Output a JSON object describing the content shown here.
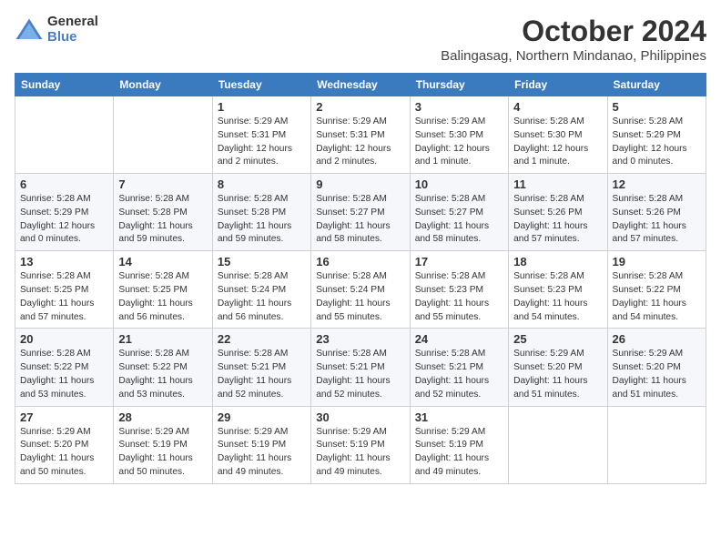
{
  "logo": {
    "general": "General",
    "blue": "Blue"
  },
  "title": "October 2024",
  "location": "Balingasag, Northern Mindanao, Philippines",
  "headers": [
    "Sunday",
    "Monday",
    "Tuesday",
    "Wednesday",
    "Thursday",
    "Friday",
    "Saturday"
  ],
  "weeks": [
    [
      {
        "day": "",
        "info": ""
      },
      {
        "day": "",
        "info": ""
      },
      {
        "day": "1",
        "info": "Sunrise: 5:29 AM\nSunset: 5:31 PM\nDaylight: 12 hours\nand 2 minutes."
      },
      {
        "day": "2",
        "info": "Sunrise: 5:29 AM\nSunset: 5:31 PM\nDaylight: 12 hours\nand 2 minutes."
      },
      {
        "day": "3",
        "info": "Sunrise: 5:29 AM\nSunset: 5:30 PM\nDaylight: 12 hours\nand 1 minute."
      },
      {
        "day": "4",
        "info": "Sunrise: 5:28 AM\nSunset: 5:30 PM\nDaylight: 12 hours\nand 1 minute."
      },
      {
        "day": "5",
        "info": "Sunrise: 5:28 AM\nSunset: 5:29 PM\nDaylight: 12 hours\nand 0 minutes."
      }
    ],
    [
      {
        "day": "6",
        "info": "Sunrise: 5:28 AM\nSunset: 5:29 PM\nDaylight: 12 hours\nand 0 minutes."
      },
      {
        "day": "7",
        "info": "Sunrise: 5:28 AM\nSunset: 5:28 PM\nDaylight: 11 hours\nand 59 minutes."
      },
      {
        "day": "8",
        "info": "Sunrise: 5:28 AM\nSunset: 5:28 PM\nDaylight: 11 hours\nand 59 minutes."
      },
      {
        "day": "9",
        "info": "Sunrise: 5:28 AM\nSunset: 5:27 PM\nDaylight: 11 hours\nand 58 minutes."
      },
      {
        "day": "10",
        "info": "Sunrise: 5:28 AM\nSunset: 5:27 PM\nDaylight: 11 hours\nand 58 minutes."
      },
      {
        "day": "11",
        "info": "Sunrise: 5:28 AM\nSunset: 5:26 PM\nDaylight: 11 hours\nand 57 minutes."
      },
      {
        "day": "12",
        "info": "Sunrise: 5:28 AM\nSunset: 5:26 PM\nDaylight: 11 hours\nand 57 minutes."
      }
    ],
    [
      {
        "day": "13",
        "info": "Sunrise: 5:28 AM\nSunset: 5:25 PM\nDaylight: 11 hours\nand 57 minutes."
      },
      {
        "day": "14",
        "info": "Sunrise: 5:28 AM\nSunset: 5:25 PM\nDaylight: 11 hours\nand 56 minutes."
      },
      {
        "day": "15",
        "info": "Sunrise: 5:28 AM\nSunset: 5:24 PM\nDaylight: 11 hours\nand 56 minutes."
      },
      {
        "day": "16",
        "info": "Sunrise: 5:28 AM\nSunset: 5:24 PM\nDaylight: 11 hours\nand 55 minutes."
      },
      {
        "day": "17",
        "info": "Sunrise: 5:28 AM\nSunset: 5:23 PM\nDaylight: 11 hours\nand 55 minutes."
      },
      {
        "day": "18",
        "info": "Sunrise: 5:28 AM\nSunset: 5:23 PM\nDaylight: 11 hours\nand 54 minutes."
      },
      {
        "day": "19",
        "info": "Sunrise: 5:28 AM\nSunset: 5:22 PM\nDaylight: 11 hours\nand 54 minutes."
      }
    ],
    [
      {
        "day": "20",
        "info": "Sunrise: 5:28 AM\nSunset: 5:22 PM\nDaylight: 11 hours\nand 53 minutes."
      },
      {
        "day": "21",
        "info": "Sunrise: 5:28 AM\nSunset: 5:22 PM\nDaylight: 11 hours\nand 53 minutes."
      },
      {
        "day": "22",
        "info": "Sunrise: 5:28 AM\nSunset: 5:21 PM\nDaylight: 11 hours\nand 52 minutes."
      },
      {
        "day": "23",
        "info": "Sunrise: 5:28 AM\nSunset: 5:21 PM\nDaylight: 11 hours\nand 52 minutes."
      },
      {
        "day": "24",
        "info": "Sunrise: 5:28 AM\nSunset: 5:21 PM\nDaylight: 11 hours\nand 52 minutes."
      },
      {
        "day": "25",
        "info": "Sunrise: 5:29 AM\nSunset: 5:20 PM\nDaylight: 11 hours\nand 51 minutes."
      },
      {
        "day": "26",
        "info": "Sunrise: 5:29 AM\nSunset: 5:20 PM\nDaylight: 11 hours\nand 51 minutes."
      }
    ],
    [
      {
        "day": "27",
        "info": "Sunrise: 5:29 AM\nSunset: 5:20 PM\nDaylight: 11 hours\nand 50 minutes."
      },
      {
        "day": "28",
        "info": "Sunrise: 5:29 AM\nSunset: 5:19 PM\nDaylight: 11 hours\nand 50 minutes."
      },
      {
        "day": "29",
        "info": "Sunrise: 5:29 AM\nSunset: 5:19 PM\nDaylight: 11 hours\nand 49 minutes."
      },
      {
        "day": "30",
        "info": "Sunrise: 5:29 AM\nSunset: 5:19 PM\nDaylight: 11 hours\nand 49 minutes."
      },
      {
        "day": "31",
        "info": "Sunrise: 5:29 AM\nSunset: 5:19 PM\nDaylight: 11 hours\nand 49 minutes."
      },
      {
        "day": "",
        "info": ""
      },
      {
        "day": "",
        "info": ""
      }
    ]
  ]
}
